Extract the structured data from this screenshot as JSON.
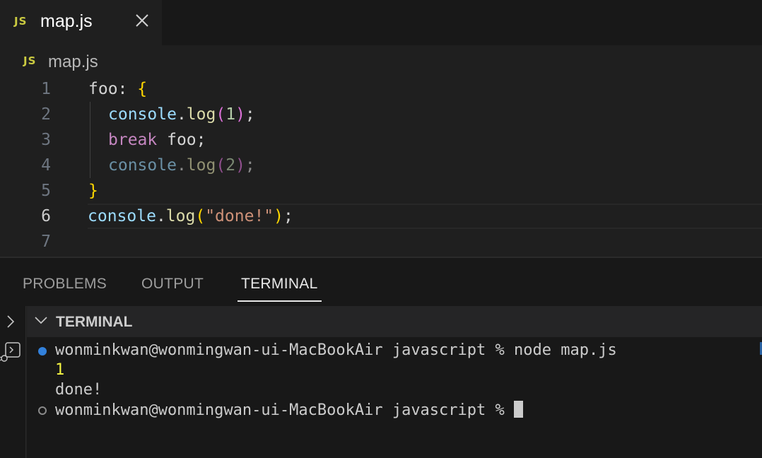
{
  "tab": {
    "badge": "JS",
    "filename": "map.js",
    "close_icon": "close-icon"
  },
  "breadcrumb": {
    "badge": "JS",
    "filename": "map.js"
  },
  "editor": {
    "line_numbers": [
      "1",
      "2",
      "3",
      "4",
      "5",
      "6",
      "7"
    ],
    "active_line": "6",
    "lines": {
      "l1": {
        "label": "foo",
        "colon": ": ",
        "brace": "{"
      },
      "l2": {
        "obj": "console",
        "dot": ".",
        "fn": "log",
        "open": "(",
        "arg": "1",
        "close": ")",
        "semi": ";"
      },
      "l3": {
        "kw": "break",
        "rest": " foo;"
      },
      "l4": {
        "obj": "console",
        "dot": ".",
        "fn": "log",
        "open": "(",
        "arg": "2",
        "close": ")",
        "semi": ";"
      },
      "l5": {
        "brace": "}"
      },
      "l6": {
        "obj": "console",
        "dot": ".",
        "fn": "log",
        "open": "(",
        "arg": "\"done!\"",
        "close": ")",
        "semi": ";"
      },
      "l7": {}
    }
  },
  "panel": {
    "tabs": [
      "PROBLEMS",
      "OUTPUT",
      "TERMINAL"
    ],
    "active_tab": "TERMINAL"
  },
  "terminal": {
    "header_title": "TERMINAL",
    "lines": [
      "wonminkwan@wonmingwan-ui-MacBookAir javascript % node map.js",
      "1",
      "done!",
      "wonminkwan@wonmingwan-ui-MacBookAir javascript % "
    ]
  },
  "colors": {
    "js_badge": "#cbcb41",
    "accent_blue": "#3794ff",
    "background": "#1f1f1f"
  }
}
